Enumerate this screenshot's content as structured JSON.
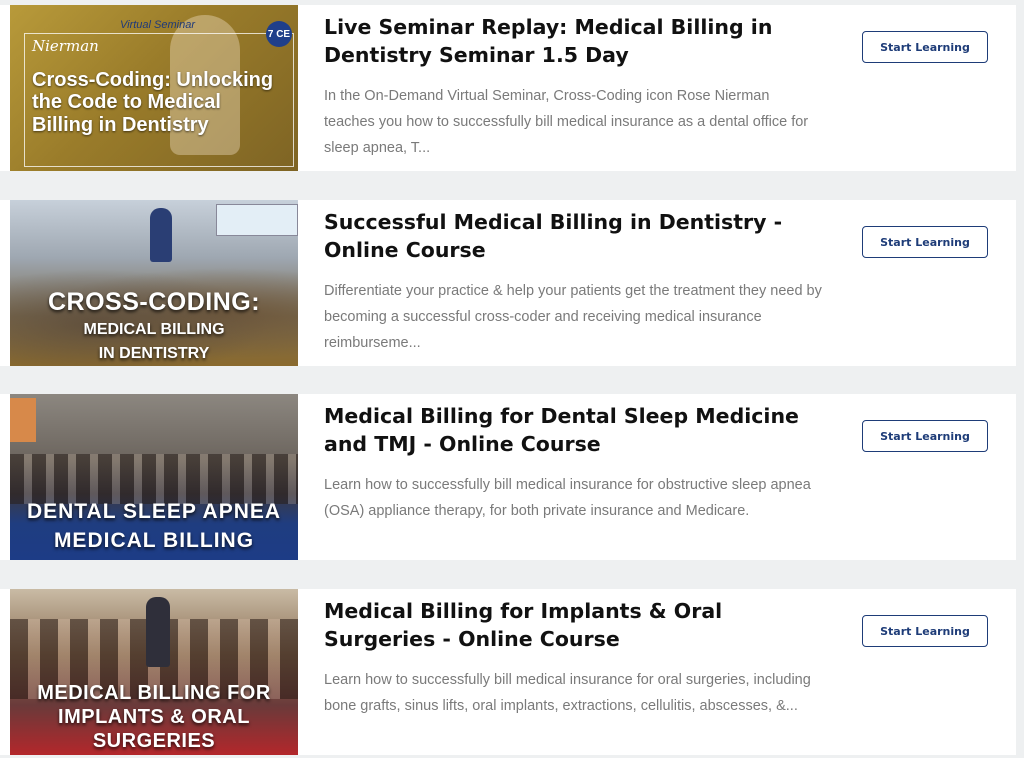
{
  "courses": [
    {
      "title": "Live Seminar Replay: Medical Billing in Dentistry Seminar 1.5 Day",
      "description": "In the On-Demand Virtual Seminar, Cross-Coding icon Rose Nierman teaches you how to successfully bill medical insurance as a dental office for sleep apnea, T...",
      "button_label": "Start Learning",
      "thumb": {
        "virtual_label": "Virtual Seminar",
        "brand": "Nierman",
        "badge": "7 CE",
        "text": "Cross-Coding: Unlocking the Code to Medical Billing in Dentistry"
      }
    },
    {
      "title": "Successful Medical Billing in Dentistry - Online Course",
      "description": "Differentiate your practice & help your patients get the treatment they need by becoming a successful cross-coder and receiving medical insurance reimburseme...",
      "button_label": "Start Learning",
      "thumb": {
        "text_big": "CROSS-CODING:",
        "text_small_1": "MEDICAL BILLING",
        "text_small_2": "IN DENTISTRY"
      }
    },
    {
      "title": "Medical Billing for Dental Sleep Medicine and TMJ - Online Course",
      "description": "Learn how to successfully bill medical insurance for obstructive sleep apnea (OSA) appliance therapy, for both private insurance and Medicare.",
      "button_label": "Start Learning",
      "thumb": {
        "line_1": "DENTAL SLEEP APNEA",
        "line_2": "MEDICAL BILLING"
      }
    },
    {
      "title": "Medical Billing for Implants & Oral Surgeries - Online Course",
      "description": "Learn how to successfully bill medical insurance for oral surgeries, including bone grafts, sinus lifts, oral implants, extractions, cellulitis, abscesses, &...",
      "button_label": "Start Learning",
      "thumb": {
        "line_1": "MEDICAL BILLING FOR",
        "line_2": "IMPLANTS & ORAL",
        "line_3": "SURGERIES"
      }
    }
  ],
  "colors": {
    "background": "#eef0f1",
    "card": "#ffffff",
    "accent": "#1e3c78",
    "description_text": "#7a7a7a"
  }
}
